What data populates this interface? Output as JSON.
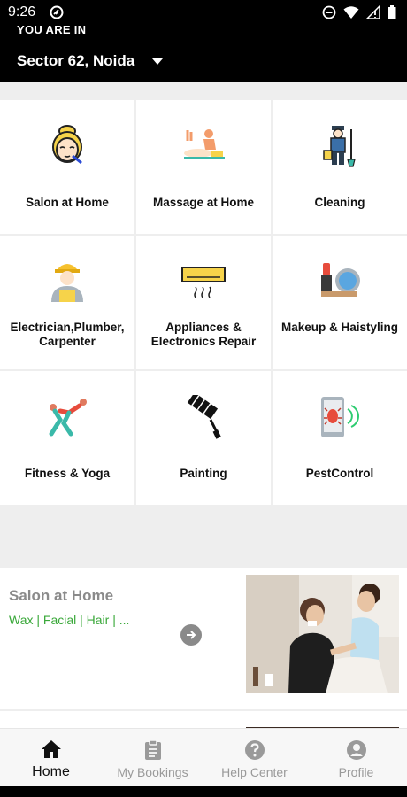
{
  "status": {
    "time": "9:26"
  },
  "header": {
    "you_are_in": "YOU ARE IN",
    "location": "Sector 62, Noida"
  },
  "services": [
    {
      "label": "Salon at Home",
      "icon": "salon-icon"
    },
    {
      "label": "Massage at Home",
      "icon": "massage-icon"
    },
    {
      "label": "Cleaning",
      "icon": "cleaning-icon"
    },
    {
      "label": "Electrician,Plumber, Carpenter",
      "icon": "electrician-icon"
    },
    {
      "label": "Appliances & Electronics Repair",
      "icon": "appliances-icon"
    },
    {
      "label": "Makeup & Haistyling",
      "icon": "makeup-icon"
    },
    {
      "label": "Fitness & Yoga",
      "icon": "fitness-icon"
    },
    {
      "label": "Painting",
      "icon": "painting-icon"
    },
    {
      "label": "PestControl",
      "icon": "pest-control-icon"
    }
  ],
  "featured": {
    "title": "Salon at Home",
    "subtitle": "Wax | Facial | Hair | ..."
  },
  "bottom_nav": [
    {
      "label": "Home",
      "icon": "home-icon",
      "active": true
    },
    {
      "label": "My Bookings",
      "icon": "clipboard-icon",
      "active": false
    },
    {
      "label": "Help Center",
      "icon": "help-icon",
      "active": false
    },
    {
      "label": "Profile",
      "icon": "account-icon",
      "active": false
    }
  ],
  "colors": {
    "header_bg": "#000000",
    "subtitle_green": "#3aa83a",
    "muted_gray": "#9a9a9a"
  }
}
